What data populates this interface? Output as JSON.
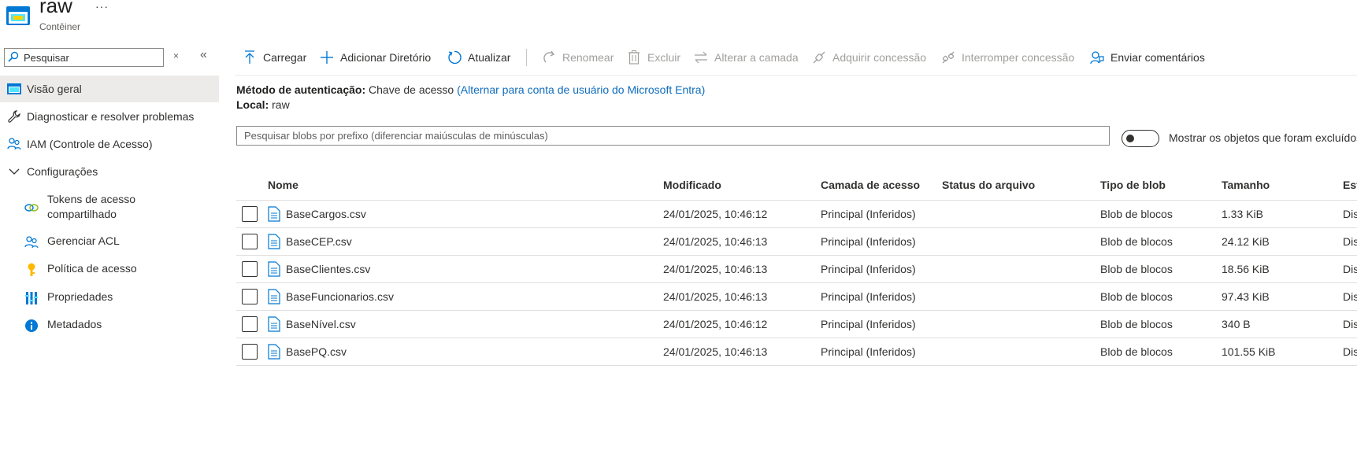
{
  "header": {
    "title": "raw",
    "subtitle": "Contêiner",
    "more": "···"
  },
  "sidebar": {
    "search_placeholder": "Pesquisar",
    "clear": "×",
    "collapse": "«",
    "items": [
      {
        "label": "Visão geral",
        "icon": "overview-icon",
        "active": true
      },
      {
        "label": "Diagnosticar e resolver problemas",
        "icon": "wrench-icon"
      },
      {
        "label": "IAM (Controle de Acesso)",
        "icon": "people-icon"
      },
      {
        "label": "Configurações",
        "icon": "chevron-down-icon"
      }
    ],
    "subitems": [
      {
        "label": "Tokens de acesso",
        "label2": "compartilhado",
        "icon": "link-icon"
      },
      {
        "label": "Gerenciar ACL",
        "icon": "people-icon"
      },
      {
        "label": "Política de acesso",
        "icon": "key-icon"
      },
      {
        "label": "Propriedades",
        "icon": "properties-icon"
      },
      {
        "label": "Metadados",
        "icon": "info-icon"
      }
    ]
  },
  "toolbar": {
    "upload": "Carregar",
    "add_dir": "Adicionar Diretório",
    "refresh": "Atualizar",
    "rename": "Renomear",
    "delete": "Excluir",
    "change_tier": "Alterar a camada",
    "acquire_lease": "Adquirir concessão",
    "break_lease": "Interromper concessão",
    "feedback": "Enviar comentários"
  },
  "info": {
    "auth_label": "Método de autenticação:",
    "auth_value": "Chave de acesso",
    "auth_link": "(Alternar para conta de usuário do Microsoft Entra)",
    "location_label": "Local:",
    "location_value": "raw"
  },
  "blob_search": {
    "placeholder": "Pesquisar blobs por prefixo (diferenciar maiúsculas de minúsculas)"
  },
  "toggle": {
    "label": "Mostrar os objetos que foram excluídos",
    "on": false
  },
  "table": {
    "columns": [
      "Nome",
      "Modificado",
      "Camada de acesso",
      "Status do arquivo",
      "Tipo de blob",
      "Tamanho",
      "Estado"
    ],
    "rows": [
      {
        "name": "BaseCargos.csv",
        "modified": "24/01/2025, 10:46:12",
        "tier": "Principal (Inferidos)",
        "status": "",
        "type": "Blob de blocos",
        "size": "1.33 KiB",
        "state": "Disponível"
      },
      {
        "name": "BaseCEP.csv",
        "modified": "24/01/2025, 10:46:13",
        "tier": "Principal (Inferidos)",
        "status": "",
        "type": "Blob de blocos",
        "size": "24.12 KiB",
        "state": "Disponível"
      },
      {
        "name": "BaseClientes.csv",
        "modified": "24/01/2025, 10:46:13",
        "tier": "Principal (Inferidos)",
        "status": "",
        "type": "Blob de blocos",
        "size": "18.56 KiB",
        "state": "Disponível"
      },
      {
        "name": "BaseFuncionarios.csv",
        "modified": "24/01/2025, 10:46:13",
        "tier": "Principal (Inferidos)",
        "status": "",
        "type": "Blob de blocos",
        "size": "97.43 KiB",
        "state": "Disponível"
      },
      {
        "name": "BaseNível.csv",
        "modified": "24/01/2025, 10:46:12",
        "tier": "Principal (Inferidos)",
        "status": "",
        "type": "Blob de blocos",
        "size": "340 B",
        "state": "Disponível"
      },
      {
        "name": "BasePQ.csv",
        "modified": "24/01/2025, 10:46:13",
        "tier": "Principal (Inferidos)",
        "status": "",
        "type": "Blob de blocos",
        "size": "101.55 KiB",
        "state": "Disponível"
      }
    ]
  },
  "colors": {
    "accent": "#0f6cbd",
    "icon_blue": "#0078d4",
    "disabled": "#a19f9d",
    "active_bg": "#edebe9"
  }
}
